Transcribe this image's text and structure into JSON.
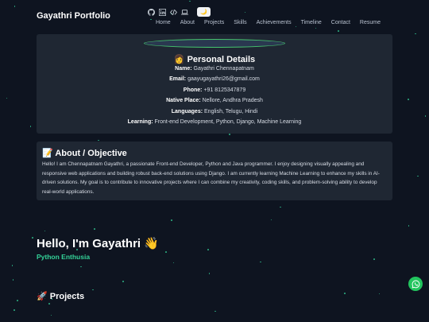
{
  "header": {
    "brand": "Gayathri Portfolio",
    "icons": [
      "github-icon",
      "linkedin-icon",
      "code-icon",
      "laptop-icon"
    ],
    "theme_toggle": "🌙",
    "nav": [
      "Home",
      "About",
      "Projects",
      "Skills",
      "Achievements",
      "Timeline",
      "Contact",
      "Resume"
    ]
  },
  "details": {
    "title": "👩 Personal Details",
    "rows": [
      {
        "label": "Name:",
        "value": "Gayathri Chennapatnam"
      },
      {
        "label": "Email:",
        "value": "gaayugayathri26@gmail.com"
      },
      {
        "label": "Phone:",
        "value": "+91 8125347879"
      },
      {
        "label": "Native Place:",
        "value": "Nellore, Andhra Pradesh"
      },
      {
        "label": "Languages:",
        "value": "English, Telugu, Hindi"
      },
      {
        "label": "Learning:",
        "value": "Front-end Development, Python, Django, Machine Learning"
      }
    ]
  },
  "about": {
    "title": "📝 About / Objective",
    "text": "Hello! I am Chennapatnam Gayathri, a passionate Front-end Developer, Python and Java programmer. I enjoy designing visually appealing and responsive web applications and building robust back-end solutions using Django. I am currently learning Machine Learning to enhance my skills in AI-driven solutions. My goal is to contribute to innovative projects where I can combine my creativity, coding skills, and problem-solving ability to develop real-world applications."
  },
  "hero": {
    "title": "Hello, I'm Gayathri 👋",
    "subtitle": "Python Enthusia"
  },
  "projects": {
    "title": "🚀 Projects"
  },
  "colors": {
    "background": "#0e1420",
    "card": "#1f2733",
    "accent": "#34d399",
    "whatsapp": "#22c55e"
  },
  "floating": {
    "icon": "whatsapp-icon"
  }
}
